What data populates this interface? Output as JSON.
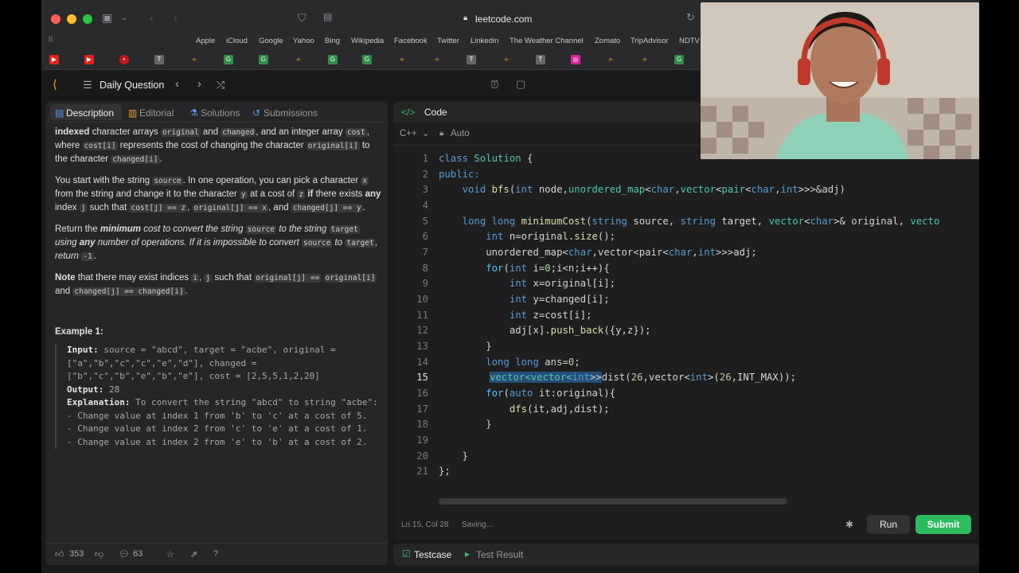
{
  "browser": {
    "url": "leetcode.com",
    "favorites": [
      "Apple",
      "iCloud",
      "Google",
      "Yahoo",
      "Bing",
      "Wikipedia",
      "Facebook",
      "Twitter",
      "Linkedin",
      "The Weather Channel",
      "Zomato",
      "TripAdvisor",
      "NDTV"
    ]
  },
  "lc": {
    "daily_label": "Daily Question"
  },
  "left": {
    "tabs": [
      "Description",
      "Editorial",
      "Solutions",
      "Submissions"
    ],
    "p0": {
      "a": "indexed",
      "b": " character arrays ",
      "c": "original",
      "d": " and ",
      "e": "changed",
      "f": ", and an integer array ",
      "g": "cost",
      "h": ", where ",
      "i": "cost[i]",
      "j": " represents the cost of changing the character ",
      "k": "original[i]",
      "l": " to the character ",
      "m": "changed[i]",
      "n": "."
    },
    "p1": {
      "a": "You start with the string ",
      "b": "source",
      "c": ". In one operation, you can pick a character ",
      "d": "x",
      "e": " from the string and change it to the character ",
      "f": "y",
      "g": " at a cost of ",
      "h": "z",
      "i": " if",
      "j": " there exists ",
      "k": "any",
      "l": " index ",
      "m": "j",
      "n": " such that ",
      "o": "cost[j] == z",
      "p": ", ",
      "q": "original[j] == x",
      "r": ", and ",
      "s": "changed[j] == y",
      "t": "."
    },
    "p2": {
      "a": "Return the ",
      "b": "minimum",
      "c": " cost to convert the string ",
      "d": "source",
      "e": " to the string ",
      "f": "target",
      "g": " using ",
      "h": "any",
      "i": " number of operations. If it is impossible to convert ",
      "j": "source",
      "k": " to ",
      "l": "target",
      "m": ", return ",
      "n": "-1",
      "o": "."
    },
    "p3": {
      "a": "Note",
      "b": " that there may exist indices ",
      "c": "i",
      "d": ", ",
      "e": "j",
      "f": " such that ",
      "g": "original[j] ==",
      "h": "original[i]",
      "i": " and ",
      "j": "changed[j] == changed[i]",
      "k": "."
    },
    "example_title": "Example 1:",
    "ex": {
      "input_label": "Input:",
      "input": " source = \"abcd\", target = \"acbe\", original = [\"a\",\"b\",\"c\",\"c\",\"e\",\"d\"], changed = [\"b\",\"c\",\"b\",\"e\",\"b\",\"e\"], cost = [2,5,5,1,2,20]",
      "output_label": "Output:",
      "output": " 28",
      "expl_label": "Explanation:",
      "expl": " To convert the string \"abcd\" to string \"acbe\":",
      "l1": "- Change value at index 1 from 'b' to 'c' at a cost of 5.",
      "l2": "- Change value at index 2 from 'c' to 'e' at a cost of 1.",
      "l3": "- Change value at index 2 from 'e' to 'b' at a cost of 2."
    },
    "likes": "353",
    "comments": "63"
  },
  "right": {
    "code_tab": "Code",
    "lang": "C++",
    "mode": "Auto",
    "status": "Ln 15, Col 28",
    "saving": "Saving...",
    "run": "Run",
    "submit": "Submit",
    "testcase": "Testcase",
    "test_result": "Test Result"
  },
  "code_lines": [
    "1",
    "2",
    "3",
    "4",
    "5",
    "6",
    "7",
    "8",
    "9",
    "10",
    "11",
    "12",
    "13",
    "14",
    "15",
    "16",
    "17",
    "18",
    "19",
    "20",
    "21"
  ],
  "code": {
    "l1a": "class ",
    "l1b": "Solution",
    " l1c": " {",
    "l2": "public:",
    "l3a": "    void ",
    "l3b": "bfs",
    "l3c": "(",
    "l3d": "int",
    " l3e": " node,",
    "l3f": "unordered_map",
    "l3g": "<",
    "l3h": "char",
    ",l3i": ",",
    "l3j": "vector",
    "l3k": "<",
    "l3l": "pair",
    "l3m": "<",
    "l3n": "char",
    "l3o": ",",
    "l3p": "int",
    "l3q": ">>>&adj)",
    "l5a": "    long long ",
    "l5b": "minimumCost",
    "l5c": "(",
    "l5d": "string",
    " l5e": " source, ",
    "l5f": "string",
    " l5g": " target, ",
    "l5h": "vector",
    "l5i": "<",
    "l5j": "char",
    "l5k": ">& original, ",
    "l5l": "vecto",
    "l6a": "        int ",
    "l6b": "n=original.",
    "l6c": "size",
    "l6d": "();",
    "l7a": "        unordered_map",
    "l7b": "<",
    "l7c": "char",
    "l7d": ",vector<pair<",
    "l7e": "char",
    "l7f": ",",
    "l7g": "int",
    "l7h": ">>>adj;",
    "l8a": "        for",
    "l8b": "(",
    "l8c": "int",
    " l8d": " i=",
    "l8e": "0",
    "l8f": ";i<n;i++){",
    "l9a": "            int",
    " l9b": " x=original[i];",
    "l10a": "            int",
    " l10b": " y=changed[i];",
    "l11a": "            int",
    " l11b": " z=cost[i];",
    "l12a": "            adj[x].",
    "l12b": "push_back",
    "l12c": "({y,z});",
    "l13": "        }",
    "l14a": "        long long",
    " l14b": " ans=",
    "l14c": "0",
    ",l14d": ";",
    "l15a": "vector<vector<",
    "l15b": "int",
    ",l15c": ">>",
    "l15d": "dist(",
    "l15e": "26",
    ",l15f": ",vector<",
    "l15g": "int",
    "l15h": ">(",
    "l15i": "26",
    "l15j": ",INT_MAX));",
    "l16a": "        for",
    "l16b": "(",
    "l16c": "auto",
    " l16d": " it:original){",
    "l17a": "            ",
    "l17b": "dfs",
    "l17c": "(it,adj,dist);",
    "l18": "        }",
    "l20": "    }",
    "l21": "};"
  }
}
